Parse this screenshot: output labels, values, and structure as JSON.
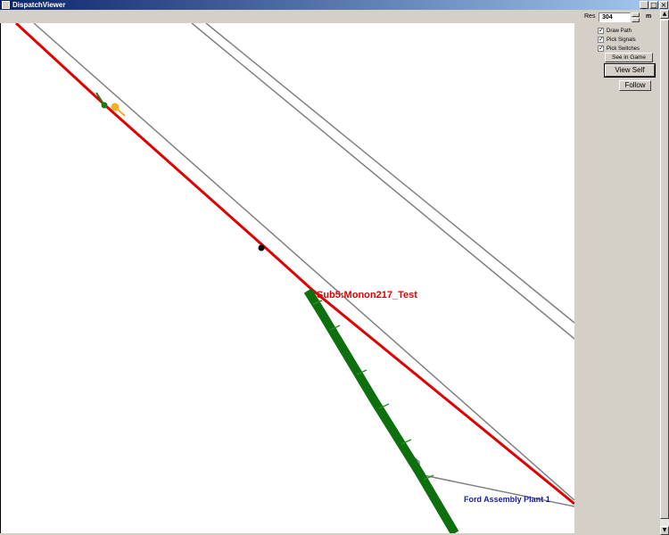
{
  "window": {
    "title": "DispatchViewer"
  },
  "controls": {
    "res_label": "Res",
    "res_value": "304",
    "res_unit": "m",
    "checkboxes": [
      {
        "label": "Draw Path",
        "checked": true
      },
      {
        "label": "Pick Signals",
        "checked": true
      },
      {
        "label": "Pick Switches",
        "checked": true
      }
    ],
    "see_in_game": "See in Game",
    "view_self": "View Self",
    "follow": "Follow"
  },
  "map": {
    "train_label": "Sub5:Monon217_Test",
    "place_label": "Ford Assembly Plant 1",
    "colors": {
      "path": "#e00000",
      "track": "#808080",
      "occupied": "#0d6f0d",
      "train_label": "#e00000",
      "place_label": "#1a1aa8",
      "signal_green": "#1a7a1a",
      "signal_yellow": "#f0b020"
    }
  }
}
